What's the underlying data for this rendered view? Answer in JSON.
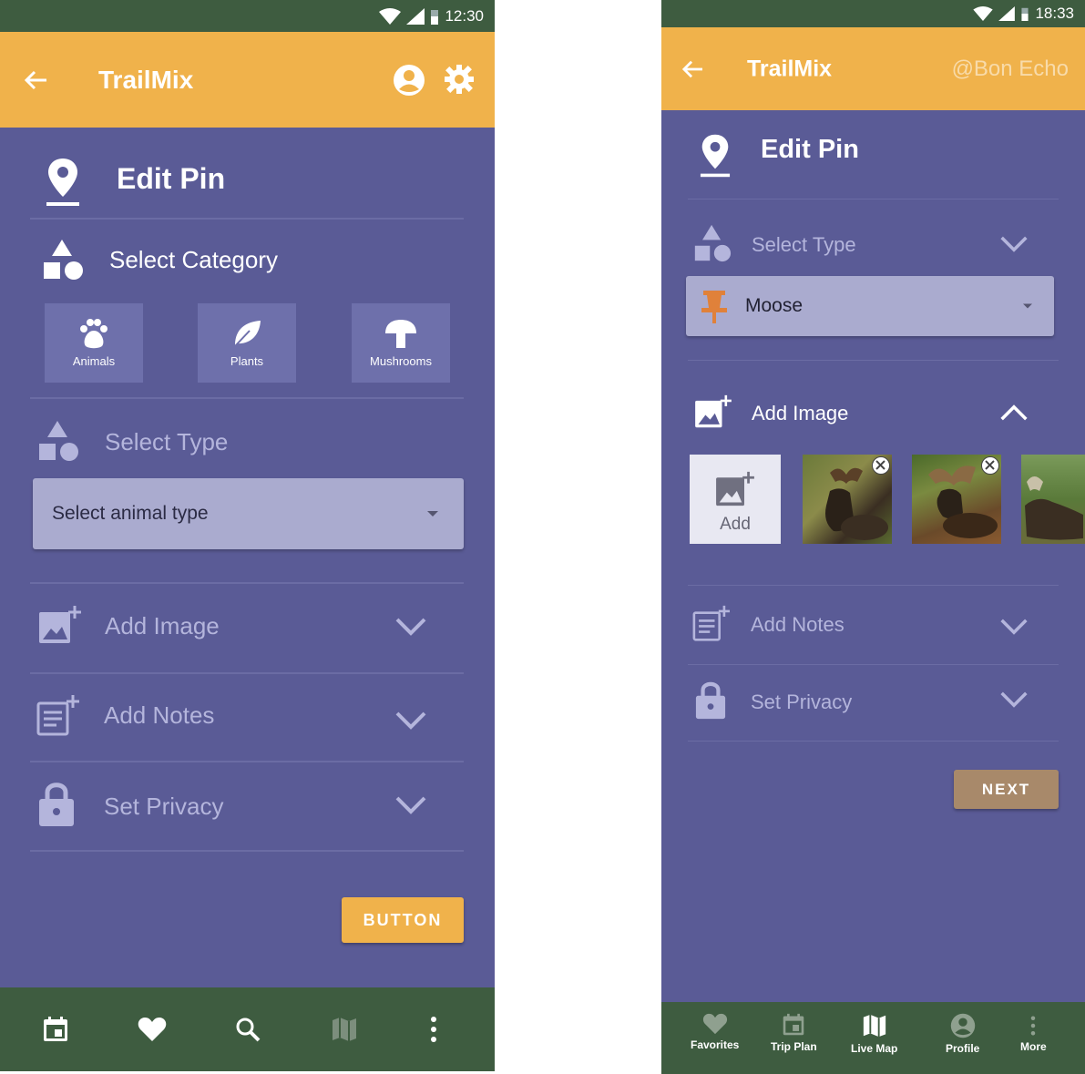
{
  "left": {
    "status": {
      "time": "12:30"
    },
    "appbar": {
      "title": "TrailMix"
    },
    "page_title": "Edit Pin",
    "category": {
      "label": "Select Category",
      "tiles": [
        {
          "label": "Animals",
          "icon": "paw-icon"
        },
        {
          "label": "Plants",
          "icon": "leaf-icon"
        },
        {
          "label": "Mushrooms",
          "icon": "mushroom-icon"
        }
      ]
    },
    "type": {
      "label": "Select Type",
      "select_value": "Select animal type"
    },
    "add_image": {
      "label": "Add Image"
    },
    "add_notes": {
      "label": "Add Notes"
    },
    "privacy": {
      "label": "Set Privacy"
    },
    "button_label": "BUTTON",
    "nav": [
      "calendar-icon",
      "heart-icon",
      "search-icon",
      "map-icon",
      "more-vert-icon"
    ]
  },
  "right": {
    "status": {
      "time": "18:33"
    },
    "appbar": {
      "title": "TrailMix",
      "user": "@Bon Echo"
    },
    "page_title": "Edit Pin",
    "type": {
      "label": "Select Type",
      "select_value": "Moose"
    },
    "add_image": {
      "label": "Add Image",
      "add_label": "Add"
    },
    "add_notes": {
      "label": "Add Notes"
    },
    "privacy": {
      "label": "Set Privacy"
    },
    "next_label": "NEXT",
    "nav": [
      {
        "label": "Favorites",
        "icon": "heart-icon"
      },
      {
        "label": "Trip Plan",
        "icon": "calendar-icon"
      },
      {
        "label": "Live Map",
        "icon": "map-icon"
      },
      {
        "label": "Profile",
        "icon": "account-icon"
      },
      {
        "label": "More",
        "icon": "more-vert-icon"
      }
    ]
  },
  "colors": {
    "primary_bg": "#5a5b96",
    "appbar": "#f0b24b",
    "statusbar": "#3e5c40",
    "button_left": "#f0b24b",
    "button_right": "#a8896a"
  }
}
